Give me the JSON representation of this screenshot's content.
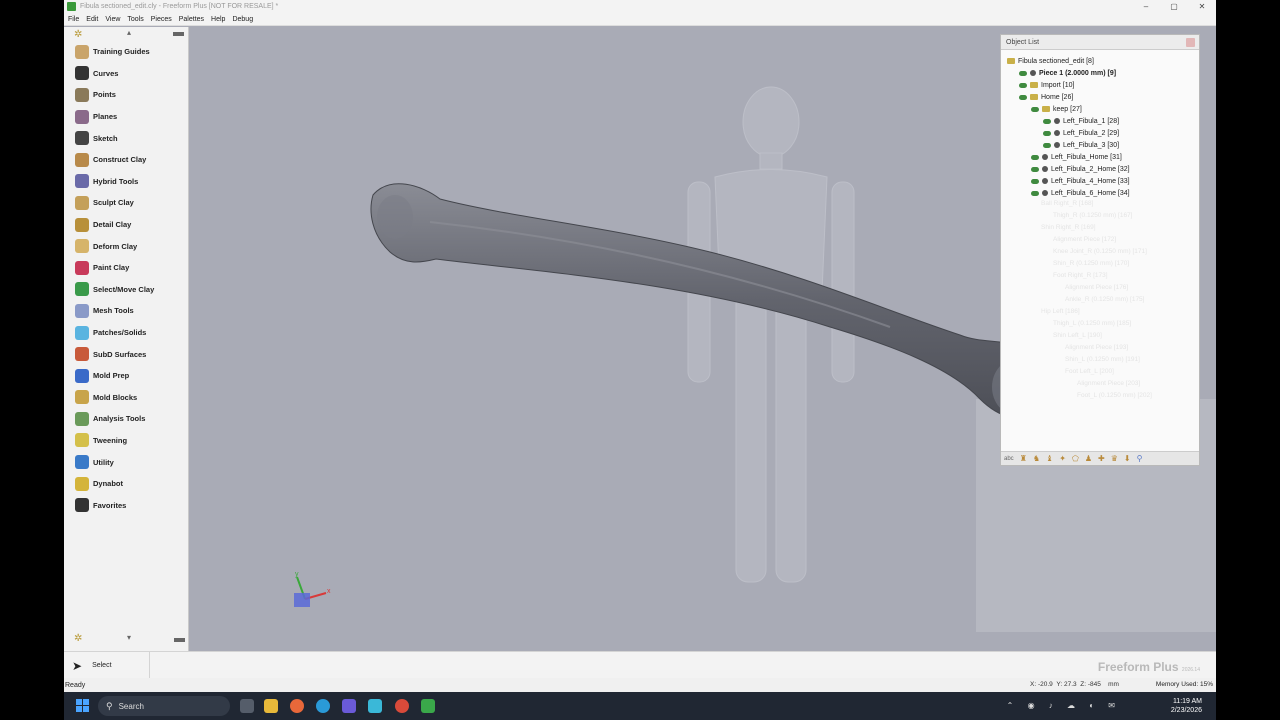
{
  "window": {
    "title": "Fibula sectioned_edit.cly - Freeform Plus [NOT FOR RESALE] *",
    "controls": [
      "–",
      "▢",
      "✕"
    ]
  },
  "menu": [
    "File",
    "Edit",
    "View",
    "Tools",
    "Pieces",
    "Palettes",
    "Help",
    "Debug"
  ],
  "palette": {
    "items": [
      {
        "label": "Training Guides",
        "icon": "training-guides-icon",
        "color": "#c9a46a"
      },
      {
        "label": "Curves",
        "icon": "curves-icon",
        "color": "#333333"
      },
      {
        "label": "Points",
        "icon": "points-icon",
        "color": "#8a7a5a"
      },
      {
        "label": "Planes",
        "icon": "planes-icon",
        "color": "#8a6a8a"
      },
      {
        "label": "Sketch",
        "icon": "sketch-icon",
        "color": "#444444"
      },
      {
        "label": "Construct Clay",
        "icon": "construct-clay-icon",
        "color": "#b88a4a"
      },
      {
        "label": "Hybrid Tools",
        "icon": "hybrid-tools-icon",
        "color": "#6a6aa8"
      },
      {
        "label": "Sculpt Clay",
        "icon": "sculpt-clay-icon",
        "color": "#c4a05a"
      },
      {
        "label": "Detail Clay",
        "icon": "detail-clay-icon",
        "color": "#b8903a"
      },
      {
        "label": "Deform Clay",
        "icon": "deform-clay-icon",
        "color": "#d6b46a"
      },
      {
        "label": "Paint Clay",
        "icon": "paint-clay-icon",
        "color": "#c83a5a"
      },
      {
        "label": "Select/Move Clay",
        "icon": "select-move-clay-icon",
        "color": "#3a9a4a"
      },
      {
        "label": "Mesh Tools",
        "icon": "mesh-tools-icon",
        "color": "#8a9ac8"
      },
      {
        "label": "Patches/Solids",
        "icon": "patches-solids-icon",
        "color": "#5ab4e0"
      },
      {
        "label": "SubD Surfaces",
        "icon": "subd-surfaces-icon",
        "color": "#c85a3a"
      },
      {
        "label": "Mold Prep",
        "icon": "mold-prep-icon",
        "color": "#3a6ac8"
      },
      {
        "label": "Mold Blocks",
        "icon": "mold-blocks-icon",
        "color": "#c8a44a"
      },
      {
        "label": "Analysis Tools",
        "icon": "analysis-tools-icon",
        "color": "#6a9a5a"
      },
      {
        "label": "Tweening",
        "icon": "tweening-icon",
        "color": "#d4c04a"
      },
      {
        "label": "Utility",
        "icon": "utility-icon",
        "color": "#3a7ac8"
      },
      {
        "label": "Dynabot",
        "icon": "dynabot-icon",
        "color": "#d4b43a"
      },
      {
        "label": "Favorites",
        "icon": "favorites-icon",
        "color": "#333333"
      }
    ]
  },
  "object_list": {
    "title": "Object List",
    "rows": [
      {
        "text": "Fibula sectioned_edit [8]",
        "bold": false,
        "indent": 0
      },
      {
        "text": "Piece 1 (2.0000 mm) [9]",
        "bold": true,
        "indent": 1
      },
      {
        "text": "Import [10]",
        "bold": false,
        "indent": 1
      },
      {
        "text": "Home [26]",
        "bold": false,
        "indent": 1
      },
      {
        "text": "keep [27]",
        "bold": false,
        "indent": 2
      },
      {
        "text": "Left_Fibula_1 [28]",
        "bold": false,
        "indent": 3
      },
      {
        "text": "Left_Fibula_2 [29]",
        "bold": false,
        "indent": 3
      },
      {
        "text": "Left_Fibula_3 [30]",
        "bold": false,
        "indent": 3
      },
      {
        "text": "Left_Fibula_Home [31]",
        "bold": false,
        "indent": 2
      },
      {
        "text": "Left_Fibula_2_Home [32]",
        "bold": false,
        "indent": 2
      },
      {
        "text": "Left_Fibula_4_Home [33]",
        "bold": false,
        "indent": 2
      },
      {
        "text": "Left_Fibula_6_Home [34]",
        "bold": false,
        "indent": 2
      }
    ]
  },
  "toolbar_bottom": {
    "select_label": "Select"
  },
  "brand": {
    "name": "Freeform Plus"
  },
  "status": {
    "ready": "Ready",
    "x": "X: -20.9",
    "y": "Y: 27.3",
    "z": "Z: -845",
    "unit": "mm",
    "memory": "Memory Used: 15%"
  },
  "taskbar": {
    "search_label": "Search",
    "time": "11:19 AM",
    "date": "2/23/2026"
  },
  "colors": {
    "viewport_bg": "#a9abb6",
    "bone": "#6a6c76"
  }
}
